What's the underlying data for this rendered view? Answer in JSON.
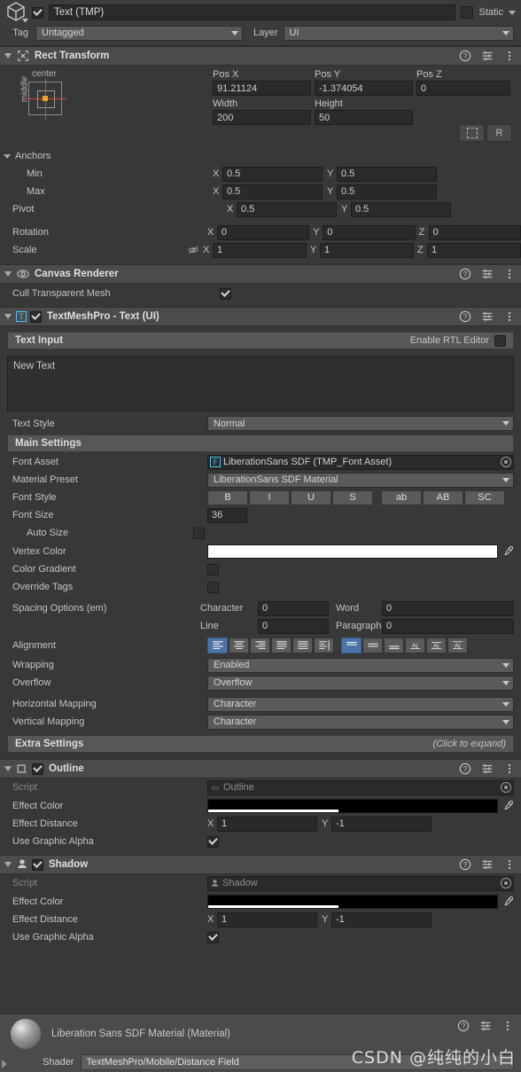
{
  "header": {
    "object_name": "Text (TMP)",
    "enabled": true,
    "static_label": "Static",
    "static_checked": false,
    "tag_label": "Tag",
    "tag_value": "Untagged",
    "layer_label": "Layer",
    "layer_value": "UI",
    "gameobject_icon": "cube-icon"
  },
  "rect_transform": {
    "title": "Rect Transform",
    "anchor_preset": {
      "top_label": "center",
      "left_label": "middle"
    },
    "pos_labels": [
      "Pos X",
      "Pos Y",
      "Pos Z"
    ],
    "pos_values": [
      "91.21124",
      "-1.374054",
      "0"
    ],
    "size_labels": [
      "Width",
      "Height"
    ],
    "size_values": [
      "200",
      "50"
    ],
    "blueprint_button": "blueprint-icon",
    "raw_button": "R",
    "anchors_label": "Anchors",
    "min_label": "Min",
    "min_x": "0.5",
    "min_y": "0.5",
    "max_label": "Max",
    "max_x": "0.5",
    "max_y": "0.5",
    "pivot_label": "Pivot",
    "pivot_x": "0.5",
    "pivot_y": "0.5",
    "rotation_label": "Rotation",
    "rotation": [
      "0",
      "0",
      "0"
    ],
    "scale_label": "Scale",
    "scale": [
      "1",
      "1",
      "1"
    ],
    "axis_x": "X",
    "axis_y": "Y",
    "axis_z": "Z"
  },
  "canvas_renderer": {
    "title": "Canvas Renderer",
    "cull_label": "Cull Transparent Mesh",
    "cull_checked": true
  },
  "tmp": {
    "title": "TextMeshPro - Text (UI)",
    "enabled": true,
    "text_input_label": "Text Input",
    "rtl_label": "Enable RTL Editor",
    "rtl_checked": false,
    "text_value": "New Text",
    "text_style_label": "Text Style",
    "text_style_value": "Normal",
    "main_settings_label": "Main Settings",
    "font_asset_label": "Font Asset",
    "font_asset_value": "LiberationSans SDF (TMP_Font Asset)",
    "material_preset_label": "Material Preset",
    "material_preset_value": "LiberationSans SDF Material",
    "font_style_label": "Font Style",
    "font_style_buttons": [
      "B",
      "I",
      "U",
      "S",
      "ab",
      "AB",
      "SC"
    ],
    "font_size_label": "Font Size",
    "font_size_value": "36",
    "auto_size_label": "Auto Size",
    "auto_size_checked": false,
    "vertex_color_label": "Vertex Color",
    "vertex_color_value": "#FFFFFF",
    "color_gradient_label": "Color Gradient",
    "color_gradient_checked": false,
    "override_tags_label": "Override Tags",
    "override_tags_checked": false,
    "spacing_label": "Spacing Options (em)",
    "spacing_character_label": "Character",
    "spacing_character_value": "0",
    "spacing_word_label": "Word",
    "spacing_word_value": "0",
    "spacing_line_label": "Line",
    "spacing_line_value": "0",
    "spacing_paragraph_label": "Paragraph",
    "spacing_paragraph_value": "0",
    "alignment_label": "Alignment",
    "alignment_horizontal": [
      "align-left-icon",
      "align-center-icon",
      "align-right-icon",
      "align-justified-icon",
      "align-flush-icon",
      "align-geometry-icon"
    ],
    "alignment_horizontal_selected": 0,
    "alignment_vertical": [
      "align-top-icon",
      "align-middle-icon",
      "align-bottom-icon",
      "align-baseline-icon",
      "align-midline-icon",
      "align-capline-icon"
    ],
    "alignment_vertical_selected": 0,
    "wrapping_label": "Wrapping",
    "wrapping_value": "Enabled",
    "overflow_label": "Overflow",
    "overflow_value": "Overflow",
    "h_mapping_label": "Horizontal Mapping",
    "h_mapping_value": "Character",
    "v_mapping_label": "Vertical Mapping",
    "v_mapping_value": "Character",
    "extra_settings_label": "Extra Settings",
    "extra_settings_hint": "(Click to expand)"
  },
  "outline": {
    "title": "Outline",
    "enabled": true,
    "script_label": "Script",
    "script_value": "Outline",
    "effect_color_label": "Effect Color",
    "effect_color_value": "#000000",
    "effect_color_alpha_pct": 45,
    "effect_distance_label": "Effect Distance",
    "effect_distance_x": "1",
    "effect_distance_y": "-1",
    "use_graphic_alpha_label": "Use Graphic Alpha",
    "use_graphic_alpha_checked": true,
    "axis_x": "X",
    "axis_y": "Y"
  },
  "shadow": {
    "title": "Shadow",
    "enabled": true,
    "script_label": "Script",
    "script_value": "Shadow",
    "effect_color_label": "Effect Color",
    "effect_color_value": "#000000",
    "effect_color_alpha_pct": 45,
    "effect_distance_label": "Effect Distance",
    "effect_distance_x": "1",
    "effect_distance_y": "-1",
    "use_graphic_alpha_label": "Use Graphic Alpha",
    "use_graphic_alpha_checked": true,
    "axis_x": "X",
    "axis_y": "Y"
  },
  "material": {
    "title": "Liberation Sans SDF Material (Material)",
    "shader_label": "Shader",
    "shader_value": "TextMeshPro/Mobile/Distance Field"
  },
  "watermark": "CSDN @纯纯的小白",
  "colors": {
    "accent_blue": "#4a74a8",
    "panel_bg": "#383838",
    "header_bg": "#4b4b4b",
    "field_bg": "#2a2a2a"
  }
}
